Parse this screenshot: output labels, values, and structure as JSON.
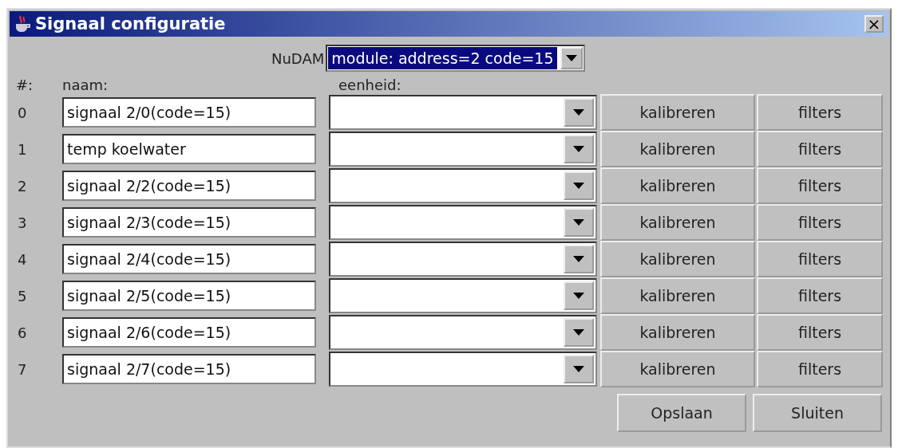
{
  "window": {
    "title": "Signaal configuratie",
    "close": "×"
  },
  "module": {
    "label": "NuDAM",
    "value": "module: address=2 code=15"
  },
  "columns": [
    "#:",
    "naam:",
    "eenheid:"
  ],
  "rows": [
    {
      "index": "0",
      "name": "signaal 2/0(code=15)",
      "calibrate": "kalibreren",
      "filters": "filters"
    },
    {
      "index": "1",
      "name": "temp koelwater",
      "calibrate": "kalibreren",
      "filters": "filters"
    },
    {
      "index": "2",
      "name": "signaal 2/2(code=15)",
      "calibrate": "kalibreren",
      "filters": "filters"
    },
    {
      "index": "3",
      "name": "signaal 2/3(code=15)",
      "calibrate": "kalibreren",
      "filters": "filters"
    },
    {
      "index": "4",
      "name": "signaal 2/4(code=15)",
      "calibrate": "kalibreren",
      "filters": "filters"
    },
    {
      "index": "5",
      "name": "signaal 2/5(code=15)",
      "calibrate": "kalibreren",
      "filters": "filters"
    },
    {
      "index": "6",
      "name": "signaal 2/6(code=15)",
      "calibrate": "kalibreren",
      "filters": "filters"
    },
    {
      "index": "7",
      "name": "signaal 2/7(code=15)",
      "calibrate": "kalibreren",
      "filters": "filters"
    }
  ],
  "buttons": [
    "Opslaan",
    "Sluiten"
  ]
}
